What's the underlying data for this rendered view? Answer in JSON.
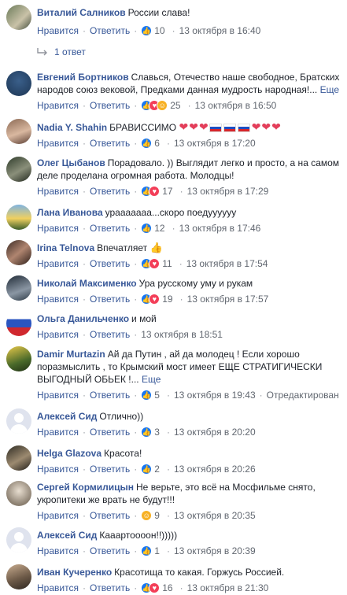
{
  "colors": {
    "link": "#385898",
    "meta": "#616770",
    "like": "#1877f2",
    "love": "#f33e58",
    "haha": "#f7b125"
  },
  "comments": [
    {
      "author": "Виталий Салников",
      "text": "России слава!",
      "like": "Нравится",
      "reply": "Ответить",
      "reactions": [
        "like"
      ],
      "count": "10",
      "time": "13 октября в 16:40",
      "replies": "1 ответ"
    },
    {
      "author": "Евгений Бортников",
      "text": "Славься, Отечество наше свободное, Братских народов союз вековой, Предками данная мудрость народная!...",
      "more": "Еще",
      "like": "Нравится",
      "reply": "Ответить",
      "reactions": [
        "like",
        "love",
        "haha"
      ],
      "count": "25",
      "time": "13 октября в 16:50"
    },
    {
      "author": "Nadia Y. Shahin",
      "text": "БРАВИССИМО",
      "emoji_after": [
        "heart",
        "heart",
        "heart",
        "flag-ru",
        "flag-ru",
        "flag-ru",
        "heart",
        "heart",
        "heart"
      ],
      "like": "Нравится",
      "reply": "Ответить",
      "reactions": [
        "like"
      ],
      "count": "6",
      "time": "13 октября в 17:20"
    },
    {
      "author": "Олег Цыбанов",
      "text": "Порадовало. )) Выглядит легко и просто, а на самом деле проделана огромная работа. Молодцы!",
      "like": "Нравится",
      "reply": "Ответить",
      "reactions": [
        "like",
        "love"
      ],
      "count": "17",
      "time": "13 октября в 17:29"
    },
    {
      "author": "Лана Иванова",
      "text": "урааааааа...скоро поедуyyyyy",
      "like": "Нравится",
      "reply": "Ответить",
      "reactions": [
        "like"
      ],
      "count": "12",
      "time": "13 октября в 17:46"
    },
    {
      "author": "Irina Telnova",
      "text": "Впечатляет",
      "emoji_after": [
        "thumbs-up"
      ],
      "like": "Нравится",
      "reply": "Ответить",
      "reactions": [
        "like",
        "love"
      ],
      "count": "11",
      "time": "13 октября в 17:54"
    },
    {
      "author": "Николай Максименко",
      "text": "Ура русскому уму и рукам",
      "like": "Нравится",
      "reply": "Ответить",
      "reactions": [
        "like",
        "love"
      ],
      "count": "19",
      "time": "13 октября в 17:57"
    },
    {
      "author": "Ольга Данильченко",
      "text": "и мой",
      "like": "Нравится",
      "reply": "Ответить",
      "reactions": [],
      "count": "",
      "time": "13 октября в 18:51"
    },
    {
      "author": "Damir Murtazin",
      "text": "Ай да Путин , ай да молодец ! Если хорошо поразмыслить , то Крымский мост имеет ЕЩЕ СТРАТИГИЧЕСКИ ВЫГОДНЫЙ ОБЬЕК !...",
      "more": "Еще",
      "like": "Нравится",
      "reply": "Ответить",
      "reactions": [
        "like"
      ],
      "count": "5",
      "time": "13 октября в 19:43",
      "edited": "Отредактирован"
    },
    {
      "author": "Алексей Сид",
      "text": "Отлично))",
      "like": "Нравится",
      "reply": "Ответить",
      "reactions": [
        "like"
      ],
      "count": "3",
      "time": "13 октября в 20:20"
    },
    {
      "author": "Helga Glazova",
      "text": "Красота!",
      "like": "Нравится",
      "reply": "Ответить",
      "reactions": [
        "like"
      ],
      "count": "2",
      "time": "13 октября в 20:26"
    },
    {
      "author": "Сергей Кормилицын",
      "text": "Не верьте, это всё на Мосфильме снято, укропитеки же врать не будут!!!",
      "like": "Нравится",
      "reply": "Ответить",
      "reactions": [
        "haha"
      ],
      "count": "9",
      "time": "13 октября в 20:35"
    },
    {
      "author": "Алексей Сид",
      "text": "Кааартоооон!!)))))",
      "like": "Нравится",
      "reply": "Ответить",
      "reactions": [
        "like"
      ],
      "count": "1",
      "time": "13 октября в 20:39"
    },
    {
      "author": "Иван Кучеренко",
      "text": "Красотища то какая. Горжусь Россией.",
      "like": "Нравится",
      "reply": "Ответить",
      "reactions": [
        "like",
        "love"
      ],
      "count": "16",
      "time": "13 октября в 21:30"
    }
  ]
}
